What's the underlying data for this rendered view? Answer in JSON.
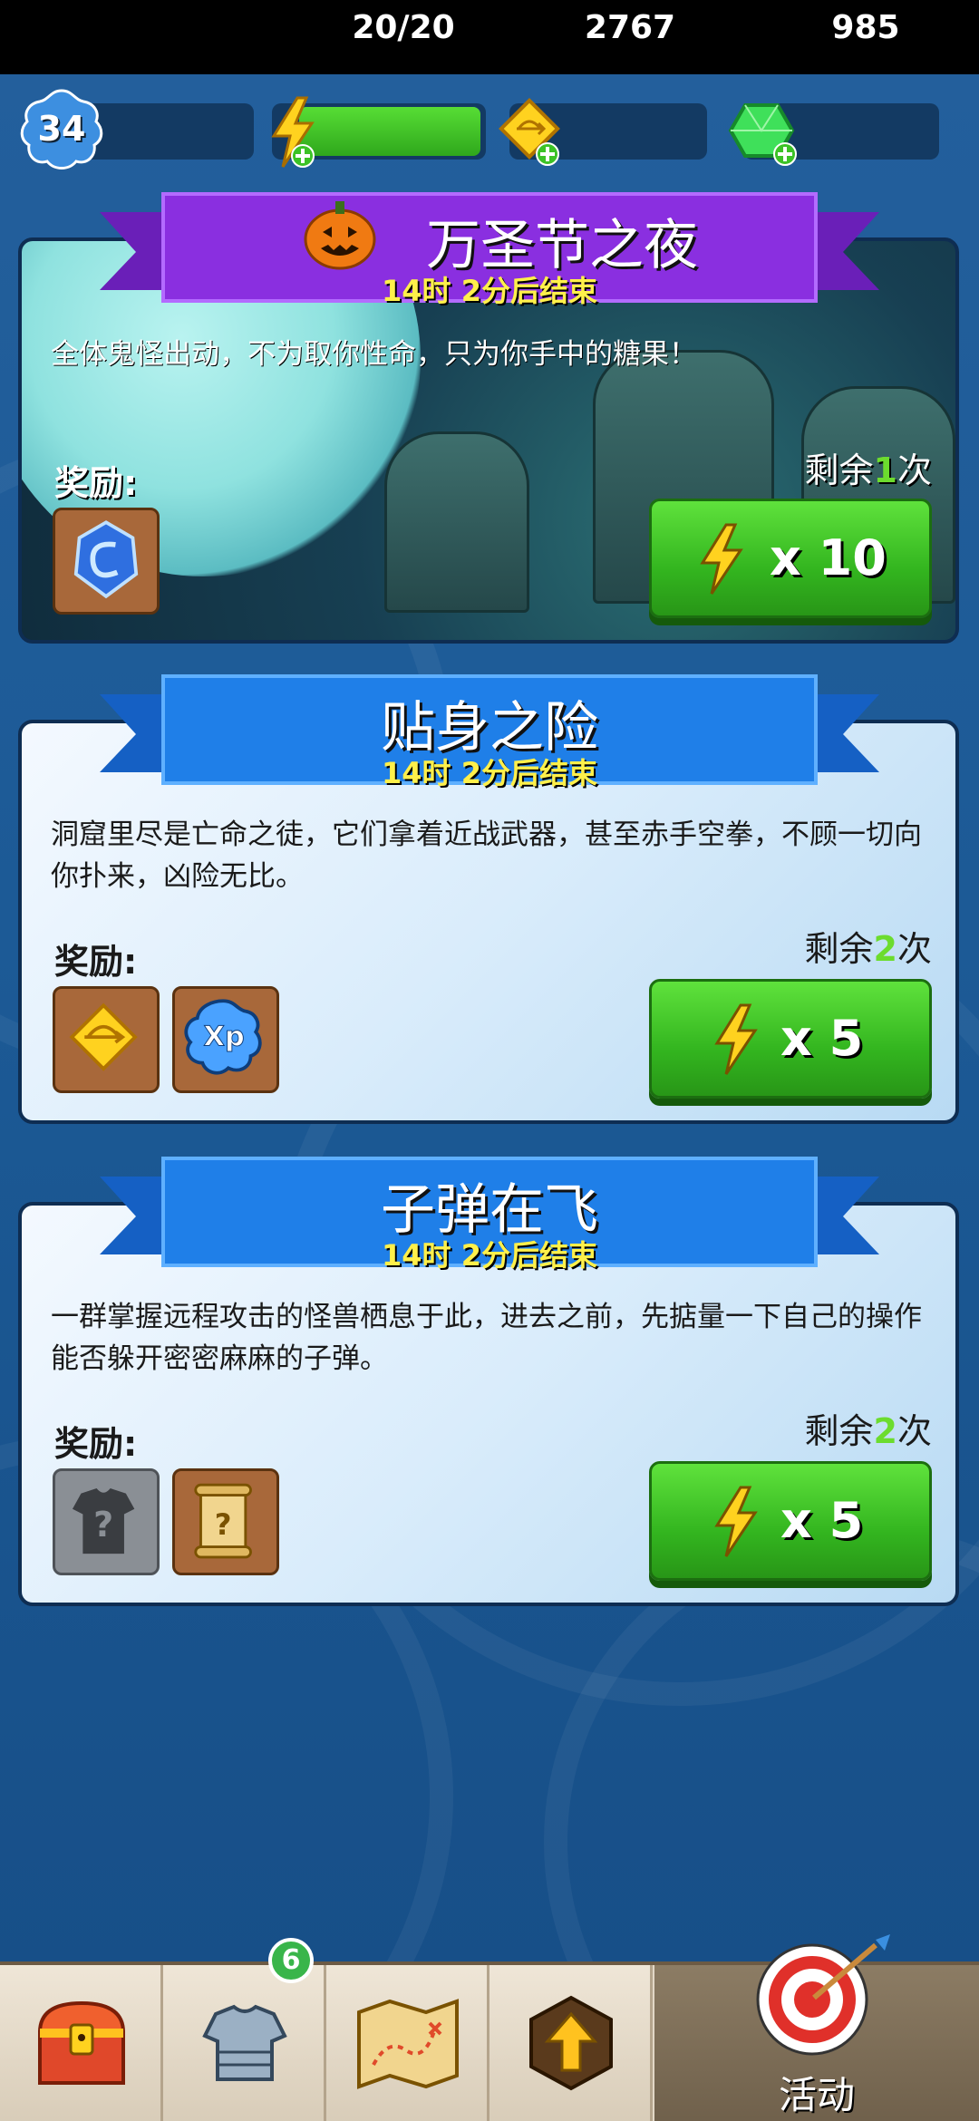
{
  "resources": {
    "level": "34",
    "energy": "20/20",
    "coins": "2767",
    "gems": "985"
  },
  "events": [
    {
      "title": "万圣节之夜",
      "timer": "14时 2分后结束",
      "description": "全体鬼怪出动，不为取你性命，只为你手中的糖果！",
      "reward_label": "奖励:",
      "remaining_prefix": "剩余",
      "remaining_count": "1",
      "remaining_suffix": "次",
      "cost": "x 10",
      "rewards": [
        "blue-rune-icon"
      ]
    },
    {
      "title": "贴身之险",
      "timer": "14时 2分后结束",
      "description": "洞窟里尽是亡命之徒，它们拿着近战武器，甚至赤手空拳，不顾一切向你扑来，凶险无比。",
      "reward_label": "奖励:",
      "remaining_prefix": "剩余",
      "remaining_count": "2",
      "remaining_suffix": "次",
      "cost": "x 5",
      "rewards": [
        "gold-bow-coin-icon",
        "xp-icon"
      ]
    },
    {
      "title": "子弹在飞",
      "timer": "14时 2分后结束",
      "description": "一群掌握远程攻击的怪兽栖息于此，进去之前，先掂量一下自己的操作能否躲开密密麻麻的子弹。",
      "reward_label": "奖励:",
      "remaining_prefix": "剩余",
      "remaining_count": "2",
      "remaining_suffix": "次",
      "cost": "x 5",
      "rewards": [
        "unknown-armor-icon",
        "scroll-icon"
      ]
    }
  ],
  "nav": {
    "items": [
      "treasure-chest-icon",
      "armor-icon",
      "map-icon",
      "upgrade-icon",
      "target-icon"
    ],
    "equipment_badge": "6",
    "active_label": "活动"
  },
  "colors": {
    "halloween_ribbon": "#8a2fe0",
    "blue_ribbon": "#1f7fe8",
    "button_green": "#3cc226",
    "timer_yellow": "#fff04a"
  }
}
